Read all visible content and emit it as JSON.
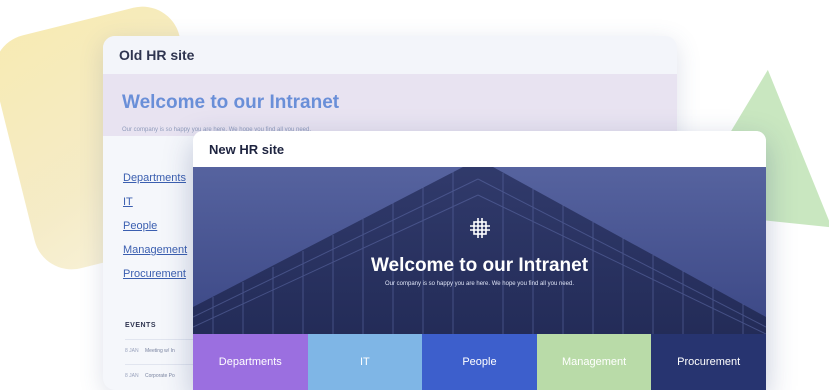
{
  "old_site": {
    "header": "Old HR site",
    "title": "Welcome to our Intranet",
    "subtitle": "Our company is so happy you are here. We hope you find all you need.",
    "nav": [
      "Departments",
      "IT",
      "People",
      "Management",
      "Procurement"
    ],
    "events": {
      "title": "EVENTS",
      "items": [
        {
          "date": "8 JAN",
          "name": "Meeting w/ In"
        },
        {
          "date": "8 JAN",
          "name": "Corporate Po"
        }
      ]
    }
  },
  "new_site": {
    "header": "New HR site",
    "title": "Welcome to our Intranet",
    "subtitle": "Our company is so happy you are here. We hope you find all you need.",
    "tiles": [
      {
        "label": "Departments",
        "color": "#9b6fe0"
      },
      {
        "label": "IT",
        "color": "#7fb6e6"
      },
      {
        "label": "People",
        "color": "#3d5fcc"
      },
      {
        "label": "Management",
        "color": "#b9dba8"
      },
      {
        "label": "Procurement",
        "color": "#273470"
      }
    ]
  }
}
